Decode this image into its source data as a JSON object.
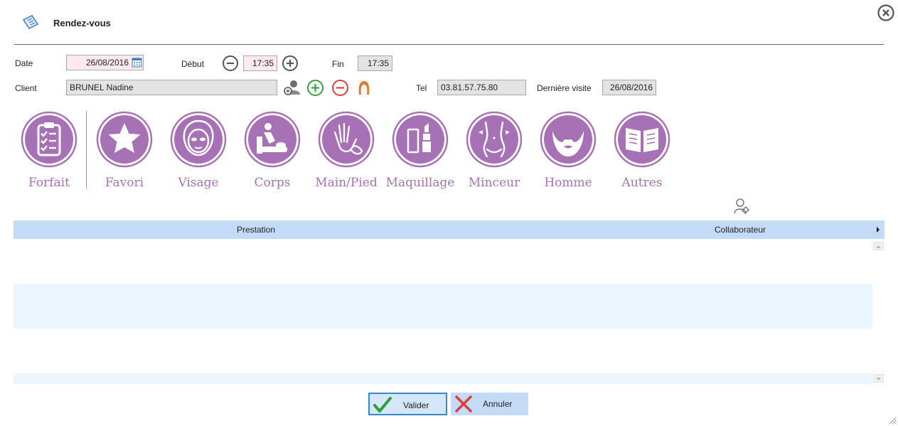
{
  "window": {
    "title": "Rendez-vous",
    "accent_color": "#a771b5"
  },
  "form": {
    "date_label": "Date",
    "date_value": "26/08/2016",
    "start_label": "Début",
    "start_value": "17:35",
    "end_label": "Fin",
    "end_value": "17:35",
    "client_label": "Client",
    "client_value": "BRUNEL Nadine",
    "tel_label": "Tel",
    "tel_value": "03.81.57.75.80",
    "last_visit_label": "Dernière visite",
    "last_visit_value": "26/08/2016"
  },
  "categories": [
    {
      "label": "Forfait",
      "icon": "clipboard-checklist-icon"
    },
    {
      "label": "Favori",
      "icon": "star-icon"
    },
    {
      "label": "Visage",
      "icon": "face-mask-icon"
    },
    {
      "label": "Corps",
      "icon": "body-massage-icon"
    },
    {
      "label": "Main/Pied",
      "icon": "hand-foot-icon"
    },
    {
      "label": "Maquillage",
      "icon": "lipstick-icon"
    },
    {
      "label": "Minceur",
      "icon": "slim-waist-icon"
    },
    {
      "label": "Homme",
      "icon": "beard-icon"
    },
    {
      "label": "Autres",
      "icon": "open-book-icon"
    }
  ],
  "table": {
    "columns": [
      "Prestation",
      "Collaborateur"
    ],
    "rows": []
  },
  "buttons": {
    "validate": "Valider",
    "cancel": "Annuler"
  }
}
